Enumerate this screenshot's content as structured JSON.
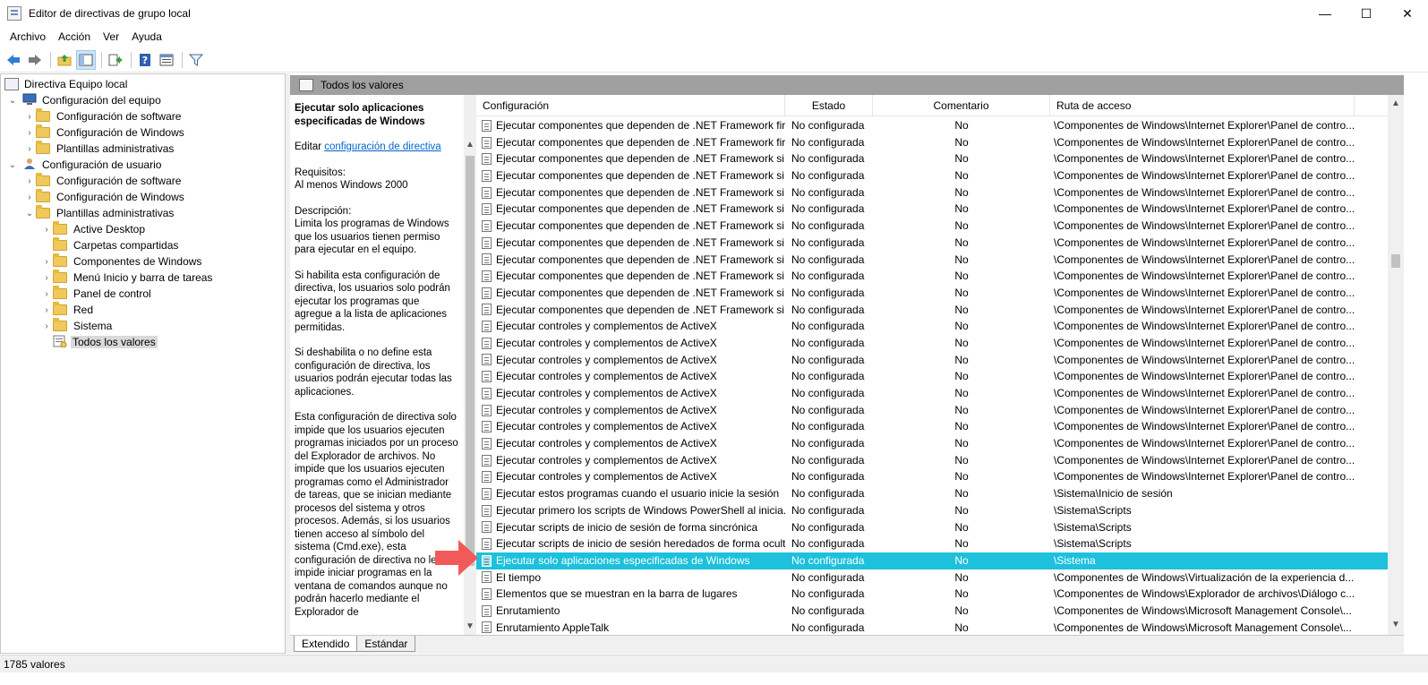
{
  "window": {
    "title": "Editor de directivas de grupo local",
    "minimize": "—",
    "maximize": "☐",
    "close": "✕"
  },
  "menu": [
    "Archivo",
    "Acción",
    "Ver",
    "Ayuda"
  ],
  "toolbar": {
    "icons": [
      "back-icon",
      "forward-icon",
      "up-folder-icon",
      "show-tree-icon",
      "export-icon",
      "help-icon",
      "properties-icon",
      "filter-icon"
    ]
  },
  "tree": {
    "items": [
      {
        "label": "Directiva Equipo local",
        "level": 0,
        "arrow": "",
        "icon": "policy"
      },
      {
        "label": "Configuración del equipo",
        "level": 1,
        "arrow": "⌄",
        "icon": "computer"
      },
      {
        "label": "Configuración de software",
        "level": 2,
        "arrow": "›",
        "icon": "folder"
      },
      {
        "label": "Configuración de Windows",
        "level": 2,
        "arrow": "›",
        "icon": "folder"
      },
      {
        "label": "Plantillas administrativas",
        "level": 2,
        "arrow": "›",
        "icon": "folder"
      },
      {
        "label": "Configuración de usuario",
        "level": 1,
        "arrow": "⌄",
        "icon": "user"
      },
      {
        "label": "Configuración de software",
        "level": 2,
        "arrow": "›",
        "icon": "folder"
      },
      {
        "label": "Configuración de Windows",
        "level": 2,
        "arrow": "›",
        "icon": "folder"
      },
      {
        "label": "Plantillas administrativas",
        "level": 2,
        "arrow": "⌄",
        "icon": "folder"
      },
      {
        "label": "Active Desktop",
        "level": 3,
        "arrow": "›",
        "icon": "folder"
      },
      {
        "label": "Carpetas compartidas",
        "level": 3,
        "arrow": "",
        "icon": "folder"
      },
      {
        "label": "Componentes de Windows",
        "level": 3,
        "arrow": "›",
        "icon": "folder"
      },
      {
        "label": "Menú Inicio y barra de tareas",
        "level": 3,
        "arrow": "›",
        "icon": "folder"
      },
      {
        "label": "Panel de control",
        "level": 3,
        "arrow": "›",
        "icon": "folder"
      },
      {
        "label": "Red",
        "level": 3,
        "arrow": "›",
        "icon": "folder"
      },
      {
        "label": "Sistema",
        "level": 3,
        "arrow": "›",
        "icon": "folder"
      },
      {
        "label": "Todos los valores",
        "level": 3,
        "arrow": "",
        "icon": "settings",
        "selected": true
      }
    ]
  },
  "right_header": {
    "title": "Todos los valores"
  },
  "description": {
    "title": "Ejecutar solo aplicaciones especificadas de Windows",
    "edit_prefix": "Editar ",
    "edit_link": "configuración de directiva",
    "requirements_label": "Requisitos:",
    "requirements_value": "Al menos Windows 2000",
    "desc_label": "Descripción:",
    "desc_text": "Limita los programas de Windows que los usuarios tienen permiso para ejecutar en el equipo.",
    "para1": "Si habilita esta configuración de directiva, los usuarios solo podrán ejecutar los programas que agregue a la lista de aplicaciones permitidas.",
    "para2": "Si deshabilita o no define esta configuración de directiva, los usuarios podrán ejecutar todas las aplicaciones.",
    "para3": "Esta configuración de directiva solo impide que los usuarios ejecuten programas iniciados por un proceso del Explorador de archivos.  No impide que los usuarios ejecuten programas como el Administrador de tareas, que se inician mediante procesos del sistema y otros procesos. Además, si los usuarios tienen acceso al símbolo del sistema (Cmd.exe), esta configuración de directiva no les impide iniciar programas en la ventana de comandos aunque no podrán hacerlo mediante el Explorador de"
  },
  "list": {
    "columns": [
      "Configuración",
      "Estado",
      "Comentario",
      "Ruta de acceso"
    ],
    "rows": [
      {
        "name": "Ejecutar componentes que dependen de .NET Framework fir...",
        "state": "No configurada",
        "comment": "No",
        "path": "\\Componentes de Windows\\Internet Explorer\\Panel de contro..."
      },
      {
        "name": "Ejecutar componentes que dependen de .NET Framework fir...",
        "state": "No configurada",
        "comment": "No",
        "path": "\\Componentes de Windows\\Internet Explorer\\Panel de contro..."
      },
      {
        "name": "Ejecutar componentes que dependen de .NET Framework si...",
        "state": "No configurada",
        "comment": "No",
        "path": "\\Componentes de Windows\\Internet Explorer\\Panel de contro..."
      },
      {
        "name": "Ejecutar componentes que dependen de .NET Framework si...",
        "state": "No configurada",
        "comment": "No",
        "path": "\\Componentes de Windows\\Internet Explorer\\Panel de contro..."
      },
      {
        "name": "Ejecutar componentes que dependen de .NET Framework si...",
        "state": "No configurada",
        "comment": "No",
        "path": "\\Componentes de Windows\\Internet Explorer\\Panel de contro..."
      },
      {
        "name": "Ejecutar componentes que dependen de .NET Framework si...",
        "state": "No configurada",
        "comment": "No",
        "path": "\\Componentes de Windows\\Internet Explorer\\Panel de contro..."
      },
      {
        "name": "Ejecutar componentes que dependen de .NET Framework si...",
        "state": "No configurada",
        "comment": "No",
        "path": "\\Componentes de Windows\\Internet Explorer\\Panel de contro..."
      },
      {
        "name": "Ejecutar componentes que dependen de .NET Framework si...",
        "state": "No configurada",
        "comment": "No",
        "path": "\\Componentes de Windows\\Internet Explorer\\Panel de contro..."
      },
      {
        "name": "Ejecutar componentes que dependen de .NET Framework si...",
        "state": "No configurada",
        "comment": "No",
        "path": "\\Componentes de Windows\\Internet Explorer\\Panel de contro..."
      },
      {
        "name": "Ejecutar componentes que dependen de .NET Framework si...",
        "state": "No configurada",
        "comment": "No",
        "path": "\\Componentes de Windows\\Internet Explorer\\Panel de contro..."
      },
      {
        "name": "Ejecutar componentes que dependen de .NET Framework si...",
        "state": "No configurada",
        "comment": "No",
        "path": "\\Componentes de Windows\\Internet Explorer\\Panel de contro..."
      },
      {
        "name": "Ejecutar componentes que dependen de .NET Framework si...",
        "state": "No configurada",
        "comment": "No",
        "path": "\\Componentes de Windows\\Internet Explorer\\Panel de contro..."
      },
      {
        "name": "Ejecutar controles y complementos de ActiveX",
        "state": "No configurada",
        "comment": "No",
        "path": "\\Componentes de Windows\\Internet Explorer\\Panel de contro..."
      },
      {
        "name": "Ejecutar controles y complementos de ActiveX",
        "state": "No configurada",
        "comment": "No",
        "path": "\\Componentes de Windows\\Internet Explorer\\Panel de contro..."
      },
      {
        "name": "Ejecutar controles y complementos de ActiveX",
        "state": "No configurada",
        "comment": "No",
        "path": "\\Componentes de Windows\\Internet Explorer\\Panel de contro..."
      },
      {
        "name": "Ejecutar controles y complementos de ActiveX",
        "state": "No configurada",
        "comment": "No",
        "path": "\\Componentes de Windows\\Internet Explorer\\Panel de contro..."
      },
      {
        "name": "Ejecutar controles y complementos de ActiveX",
        "state": "No configurada",
        "comment": "No",
        "path": "\\Componentes de Windows\\Internet Explorer\\Panel de contro..."
      },
      {
        "name": "Ejecutar controles y complementos de ActiveX",
        "state": "No configurada",
        "comment": "No",
        "path": "\\Componentes de Windows\\Internet Explorer\\Panel de contro..."
      },
      {
        "name": "Ejecutar controles y complementos de ActiveX",
        "state": "No configurada",
        "comment": "No",
        "path": "\\Componentes de Windows\\Internet Explorer\\Panel de contro..."
      },
      {
        "name": "Ejecutar controles y complementos de ActiveX",
        "state": "No configurada",
        "comment": "No",
        "path": "\\Componentes de Windows\\Internet Explorer\\Panel de contro..."
      },
      {
        "name": "Ejecutar controles y complementos de ActiveX",
        "state": "No configurada",
        "comment": "No",
        "path": "\\Componentes de Windows\\Internet Explorer\\Panel de contro..."
      },
      {
        "name": "Ejecutar controles y complementos de ActiveX",
        "state": "No configurada",
        "comment": "No",
        "path": "\\Componentes de Windows\\Internet Explorer\\Panel de contro..."
      },
      {
        "name": "Ejecutar estos programas cuando el usuario inicie la sesión",
        "state": "No configurada",
        "comment": "No",
        "path": "\\Sistema\\Inicio de sesión"
      },
      {
        "name": "Ejecutar primero los scripts de Windows PowerShell al inicia...",
        "state": "No configurada",
        "comment": "No",
        "path": "\\Sistema\\Scripts"
      },
      {
        "name": "Ejecutar scripts de inicio de sesión de forma sincrónica",
        "state": "No configurada",
        "comment": "No",
        "path": "\\Sistema\\Scripts"
      },
      {
        "name": "Ejecutar scripts de inicio de sesión heredados de forma oculta",
        "state": "No configurada",
        "comment": "No",
        "path": "\\Sistema\\Scripts"
      },
      {
        "name": "Ejecutar solo aplicaciones especificadas de Windows",
        "state": "No configurada",
        "comment": "No",
        "path": "\\Sistema",
        "selected": true
      },
      {
        "name": "El tiempo",
        "state": "No configurada",
        "comment": "No",
        "path": "\\Componentes de Windows\\Virtualización de la experiencia d..."
      },
      {
        "name": "Elementos que se muestran en la barra de lugares",
        "state": "No configurada",
        "comment": "No",
        "path": "\\Componentes de Windows\\Explorador de archivos\\Diálogo c..."
      },
      {
        "name": "Enrutamiento",
        "state": "No configurada",
        "comment": "No",
        "path": "\\Componentes de Windows\\Microsoft Management Console\\..."
      },
      {
        "name": "Enrutamiento AppleTalk",
        "state": "No configurada",
        "comment": "No",
        "path": "\\Componentes de Windows\\Microsoft Management Console\\..."
      }
    ]
  },
  "tabs": [
    "Extendido",
    "Estándar"
  ],
  "status": {
    "text": "1785 valores"
  },
  "colors": {
    "selection": "#1dc1dc",
    "arrow": "#f25a5a",
    "header_gray": "#a0a0a0"
  }
}
